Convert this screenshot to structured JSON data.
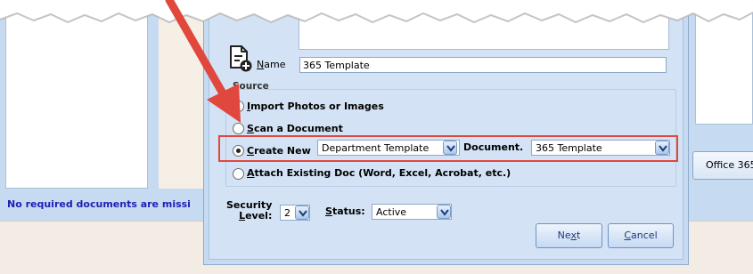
{
  "background": {
    "status_message": "No required documents are missi",
    "office_button": "Office 365"
  },
  "dialog": {
    "name": {
      "label_u": "N",
      "label_rest": "ame",
      "value": "365 Template"
    },
    "source": {
      "title": "Source",
      "options": [
        {
          "key": "import",
          "u": "I",
          "rest": "mport Photos or Images",
          "checked": false
        },
        {
          "key": "scan",
          "u": "S",
          "rest": "can a Document",
          "checked": false
        },
        {
          "key": "create",
          "u": "C",
          "rest": "reate New",
          "checked": true
        },
        {
          "key": "attach",
          "u": "A",
          "rest": "ttach Existing Doc (Word, Excel, Acrobat, etc.)",
          "checked": false
        }
      ],
      "create_new_select": "Department Template",
      "document_label": "Document.",
      "document_select": "365 Template"
    },
    "security_level": {
      "line1": "Security",
      "line2_u": "L",
      "line2_rest": "evel:",
      "value": "2"
    },
    "status": {
      "u": "S",
      "rest": "tatus:",
      "value": "Active"
    },
    "buttons": {
      "next": {
        "before": "Ne",
        "u": "x",
        "after": "t"
      },
      "cancel": {
        "u": "C",
        "rest": "ancel"
      }
    }
  },
  "colors": {
    "highlight": "#e0473d",
    "arrow": "#e0473d",
    "dialog_bg": "#c6daf1",
    "status_text": "#1f1fb5"
  }
}
